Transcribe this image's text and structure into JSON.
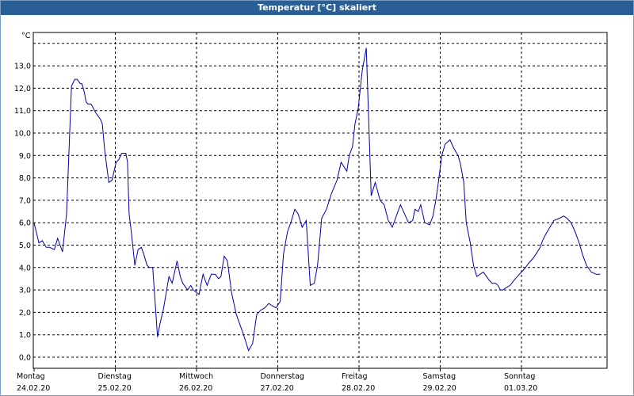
{
  "window": {
    "title": "Temperatur [°C] skaliert"
  },
  "chart_data": {
    "type": "line",
    "title": "Temperatur [°C] skaliert",
    "ylabel": "°C",
    "xlabel": "",
    "ylim": [
      -0.5,
      14.5
    ],
    "yticks": [
      0.0,
      1.0,
      2.0,
      3.0,
      4.0,
      5.0,
      6.0,
      7.0,
      8.0,
      9.0,
      10.0,
      11.0,
      12.0,
      13.0
    ],
    "ytick_labels": [
      "0,0",
      "1,0",
      "2,0",
      "3,0",
      "4,0",
      "5,0",
      "6,0",
      "7,0",
      "8,0",
      "9,0",
      "10,0",
      "11,0",
      "12,0",
      "13,0"
    ],
    "xlim": [
      0,
      7
    ],
    "x_unit": "days since Montag 24.02.20 00:00",
    "x_ticks": [
      {
        "day": "Montag",
        "date": "24.02.20"
      },
      {
        "day": "Dienstag",
        "date": "25.02.20"
      },
      {
        "day": "Mittwoch",
        "date": "26.02.20"
      },
      {
        "day": "Donnerstag",
        "date": "27.02.20"
      },
      {
        "day": "Freitag",
        "date": "28.02.20"
      },
      {
        "day": "Samstag",
        "date": "29.02.20"
      },
      {
        "day": "Sonntag",
        "date": "01.03.20"
      }
    ],
    "grid": true,
    "line_color": "#0000aa",
    "series": [
      {
        "name": "",
        "x": [
          0.0,
          0.02,
          0.06,
          0.1,
          0.15,
          0.19,
          0.25,
          0.29,
          0.35,
          0.4,
          0.46,
          0.5,
          0.53,
          0.55,
          0.57,
          0.59,
          0.62,
          0.64,
          0.66,
          0.7,
          0.76,
          0.82,
          0.84,
          0.87,
          0.92,
          0.96,
          1.01,
          1.04,
          1.08,
          1.13,
          1.15,
          1.17,
          1.2,
          1.24,
          1.28,
          1.32,
          1.35,
          1.39,
          1.42,
          1.46,
          1.52,
          1.55,
          1.59,
          1.66,
          1.7,
          1.76,
          1.8,
          1.83,
          1.89,
          1.93,
          1.96,
          2.03,
          2.08,
          2.13,
          2.18,
          2.23,
          2.27,
          2.3,
          2.34,
          2.38,
          2.43,
          2.49,
          2.57,
          2.64,
          2.69,
          2.74,
          2.79,
          2.84,
          2.89,
          2.93,
          2.98,
          3.03,
          3.07,
          3.12,
          3.16,
          3.21,
          3.25,
          3.3,
          3.35,
          3.4,
          3.45,
          3.49,
          3.54,
          3.6,
          3.66,
          3.73,
          3.78,
          3.85,
          3.88,
          3.92,
          3.95,
          3.99,
          4.04,
          4.09,
          4.15,
          4.2,
          4.26,
          4.31,
          4.36,
          4.41,
          4.46,
          4.51,
          4.56,
          4.61,
          4.66,
          4.69,
          4.73,
          4.76,
          4.81,
          4.87,
          4.91,
          4.95,
          4.98,
          5.02,
          5.06,
          5.12,
          5.17,
          5.22,
          5.25,
          5.29,
          5.32,
          5.37,
          5.41,
          5.45,
          5.49,
          5.53,
          5.57,
          5.61,
          5.64,
          5.68,
          5.71,
          5.74,
          5.77,
          5.81,
          5.86,
          5.9,
          5.95,
          6.0,
          6.05,
          6.09,
          6.14,
          6.18,
          6.23,
          6.26,
          6.3,
          6.35,
          6.4,
          6.47,
          6.52,
          6.56,
          6.61,
          6.66,
          6.71,
          6.75,
          6.8,
          6.86,
          6.92,
          6.97
        ],
        "y": [
          6.0,
          5.7,
          5.1,
          5.2,
          4.9,
          4.9,
          4.8,
          5.3,
          4.7,
          6.4,
          12.1,
          12.4,
          12.4,
          12.3,
          12.2,
          12.2,
          11.8,
          11.4,
          11.3,
          11.3,
          10.9,
          10.6,
          10.4,
          9.2,
          7.8,
          7.9,
          8.7,
          8.8,
          9.1,
          9.1,
          8.7,
          6.4,
          5.5,
          4.1,
          4.8,
          4.9,
          4.6,
          4.1,
          4.0,
          4.0,
          0.9,
          1.5,
          2.1,
          3.6,
          3.3,
          4.3,
          3.6,
          3.3,
          3.0,
          3.2,
          3.0,
          2.8,
          3.7,
          3.2,
          3.7,
          3.7,
          3.5,
          3.6,
          4.5,
          4.3,
          2.9,
          1.9,
          1.1,
          0.3,
          0.6,
          1.9,
          2.1,
          2.2,
          2.4,
          2.3,
          2.2,
          2.5,
          4.6,
          5.6,
          6.0,
          6.6,
          6.4,
          5.8,
          6.1,
          3.2,
          3.3,
          4.1,
          6.2,
          6.6,
          7.3,
          7.9,
          8.7,
          8.3,
          9.0,
          9.4,
          10.4,
          11.1,
          12.8,
          13.8,
          7.2,
          7.8,
          7.0,
          6.8,
          6.1,
          5.8,
          6.3,
          6.8,
          6.4,
          6.0,
          6.1,
          6.6,
          6.5,
          6.8,
          6.0,
          5.9,
          6.3,
          7.1,
          7.9,
          9.0,
          9.5,
          9.7,
          9.3,
          9.0,
          8.6,
          7.8,
          6.0,
          5.1,
          4.1,
          3.6,
          3.7,
          3.8,
          3.6,
          3.4,
          3.3,
          3.3,
          3.2,
          3.0,
          3.0,
          3.1,
          3.2,
          3.4,
          3.6,
          3.8,
          4.0,
          4.2,
          4.4,
          4.6,
          4.9,
          5.2,
          5.5,
          5.8,
          6.1,
          6.2,
          6.3,
          6.2,
          6.0,
          5.6,
          5.1,
          4.6,
          4.1,
          3.8,
          3.7,
          3.7
        ]
      }
    ]
  }
}
